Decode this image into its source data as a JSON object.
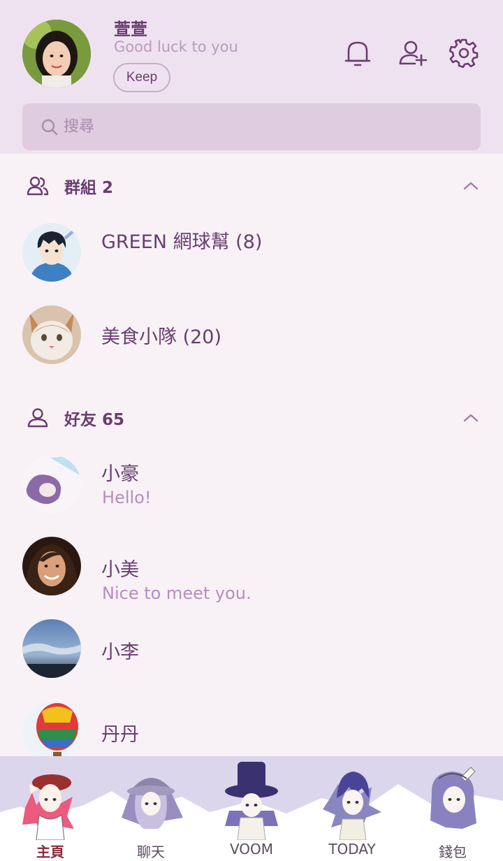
{
  "profile": {
    "name": "萱萱",
    "status": "Good luck to you",
    "keep_label": "Keep"
  },
  "header_icons": [
    "bell-icon",
    "add-friend-icon",
    "gear-icon"
  ],
  "search": {
    "placeholder": "搜尋"
  },
  "groups": {
    "title": "群組 2",
    "items": [
      {
        "name": "GREEN 網球幫 (8)"
      },
      {
        "name": "美食小隊 (20)"
      }
    ]
  },
  "friends": {
    "title": "好友 65",
    "items": [
      {
        "name": "小豪",
        "message": "Hello!"
      },
      {
        "name": "小美",
        "message": "Nice to meet you."
      },
      {
        "name": "小李"
      },
      {
        "name": "丹丹"
      }
    ]
  },
  "bottom_nav": {
    "active": "主頁",
    "items": [
      {
        "label": "主頁"
      },
      {
        "label": "聊天"
      },
      {
        "label": "VOOM"
      },
      {
        "label": "TODAY"
      },
      {
        "label": "錢包"
      }
    ]
  },
  "colors": {
    "header_bg": "#efe2f0",
    "list_bg": "#f8f2f7",
    "accent": "#6a3d70",
    "message": "#b98bc0",
    "nav_bg": "#dcd6ec"
  }
}
